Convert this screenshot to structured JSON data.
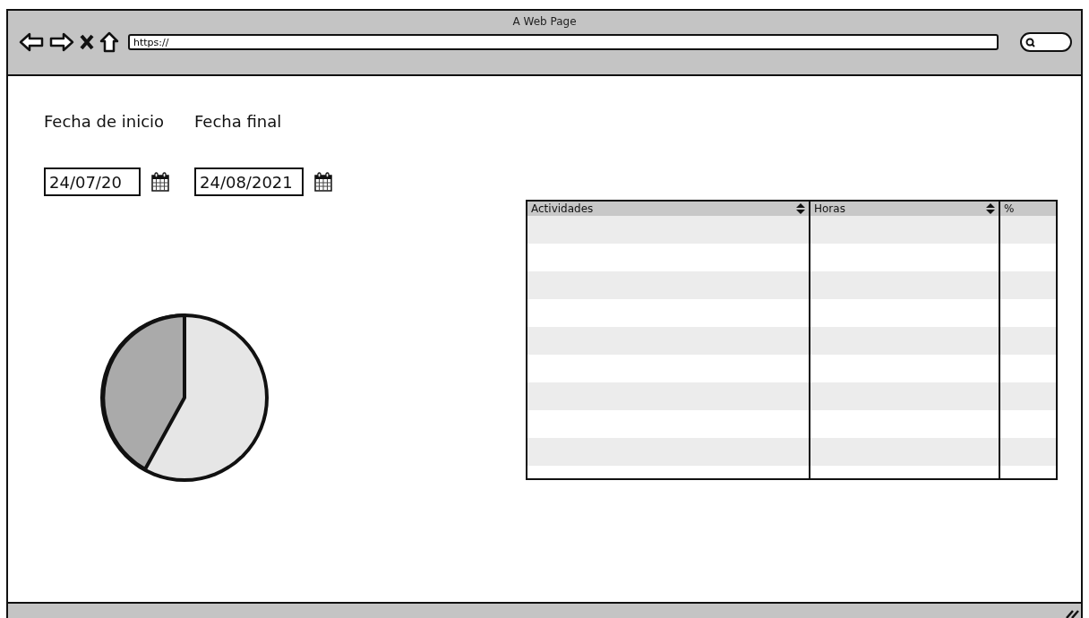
{
  "window": {
    "title": "A Web Page"
  },
  "address_bar": {
    "value": "https://"
  },
  "date_filters": [
    {
      "label": "Fecha de inicio",
      "value": "24/07/20"
    },
    {
      "label": "Fecha final",
      "value": "24/08/2021"
    }
  ],
  "table": {
    "columns": [
      {
        "label": "Actividades",
        "sortable": true
      },
      {
        "label": "Horas",
        "sortable": true
      },
      {
        "label": "%",
        "sortable": false
      }
    ]
  }
}
